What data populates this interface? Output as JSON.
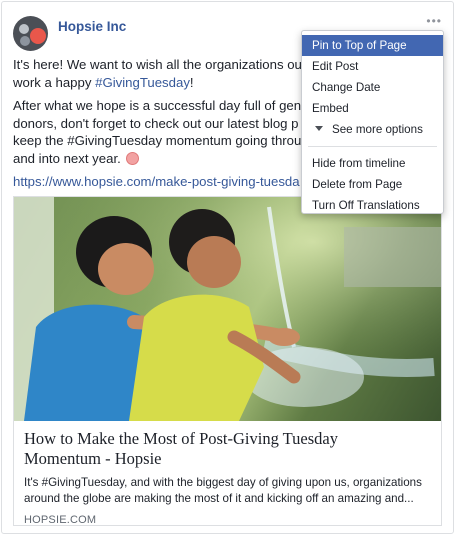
{
  "page": {
    "name": "Hopsie Inc",
    "more": "•••"
  },
  "post": {
    "line1": "It's here! We want to wish all the organizations out",
    "line2_before": "work a happy ",
    "line2_hashtag": "#GivingTuesday",
    "line2_after": "!",
    "line3": "After what we hope is a successful day full of gene",
    "line4": "donors, don't forget to check out our latest blog p",
    "line5": "keep the #GivingTuesday momentum going throug",
    "line6": "and into next year.",
    "emoji": "present-emoji",
    "link": "https://www.hopsie.com/make-post-giving-tuesda"
  },
  "attachment": {
    "title_line1": "How to Make the Most of Post-Giving Tuesday",
    "title_line2": "Momentum - Hopsie",
    "desc_line1": "It's #GivingTuesday, and with the biggest day of giving upon us, organizations",
    "desc_line2": "around the globe are making the most of it and kicking off an amazing and...",
    "domain": "HOPSIE.COM"
  },
  "menu": {
    "items_top": [
      "Pin to Top of Page",
      "Edit Post",
      "Change Date",
      "Embed"
    ],
    "see_more": "See more options",
    "items_bottom": [
      "Hide from timeline",
      "Delete from Page",
      "Turn Off Translations"
    ],
    "active_color": "#4267b2"
  },
  "colors": {
    "link": "#365899",
    "brand_red": "#e9574b"
  }
}
